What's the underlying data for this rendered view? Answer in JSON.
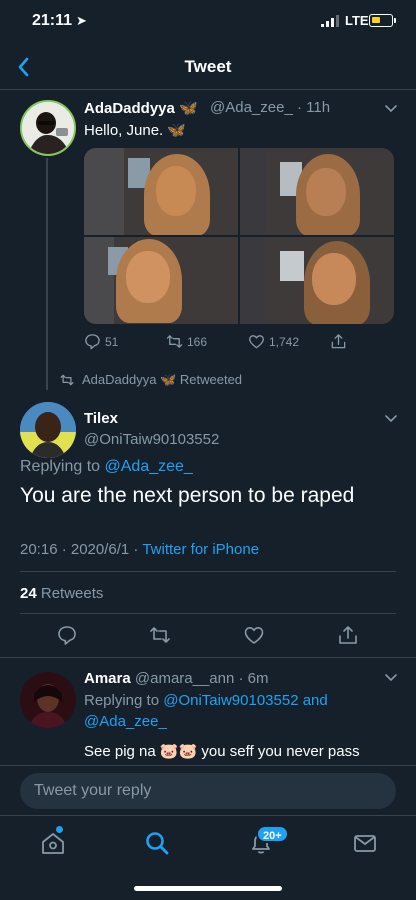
{
  "status_bar": {
    "time": "21:11",
    "network": "LTE",
    "battery_level": 0.45,
    "battery_color": "#f5d320"
  },
  "nav": {
    "title": "Tweet"
  },
  "original_tweet": {
    "name": "AdaDaddyya",
    "name_emoji": "🦋",
    "handle": "@Ada_zee_",
    "time": "· 11h",
    "text": "Hello, June.",
    "text_emoji": "🦋",
    "stats": {
      "replies": "51",
      "retweets": "166",
      "likes": "1,742"
    }
  },
  "retweeted_by": {
    "name": "AdaDaddyya",
    "emoji": "🦋",
    "label": "Retweeted"
  },
  "main_tweet": {
    "name": "Tilex",
    "handle": "@OniTaiw90103552",
    "replying_prefix": "Replying to",
    "replying_to": "@Ada_zee_",
    "text": "You are the next person to be raped",
    "timestamp": "20:16 · 2020/6/1 ·",
    "source": "Twitter for iPhone",
    "retweet_count": "24",
    "retweet_label": "Retweets"
  },
  "reply": {
    "name": "Amara",
    "handle": "@amara__ann",
    "time": "· 6m",
    "replying_prefix": "Replying to",
    "replying_to_1": "@OniTaiw90103552 and",
    "replying_to_2": "@Ada_zee_",
    "text": "See pig na 🐷🐷 you seff you never pass"
  },
  "compose": {
    "placeholder": "Tweet your reply"
  },
  "tabbar": {
    "notifications_badge": "20+"
  },
  "colors": {
    "background": "#15202b",
    "accent": "#1da1f2",
    "muted": "#8899a6",
    "border": "#38444d"
  },
  "icons": [
    "back-chevron-icon",
    "verified-butterfly-icon",
    "reply-icon",
    "retweet-icon",
    "like-icon",
    "share-icon",
    "caret-down-icon",
    "home-icon",
    "search-icon",
    "notifications-icon",
    "messages-icon"
  ]
}
